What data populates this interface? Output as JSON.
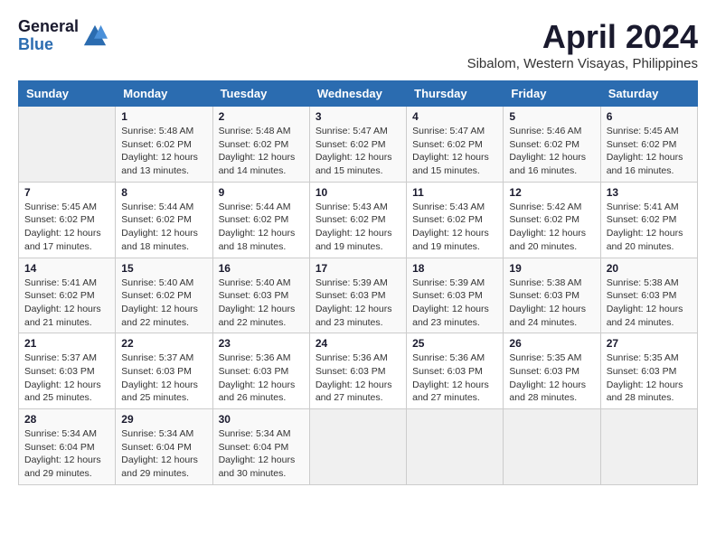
{
  "header": {
    "logo_line1": "General",
    "logo_line2": "Blue",
    "month_title": "April 2024",
    "subtitle": "Sibalom, Western Visayas, Philippines"
  },
  "calendar": {
    "days_of_week": [
      "Sunday",
      "Monday",
      "Tuesday",
      "Wednesday",
      "Thursday",
      "Friday",
      "Saturday"
    ],
    "weeks": [
      [
        {
          "day": "",
          "info": ""
        },
        {
          "day": "1",
          "info": "Sunrise: 5:48 AM\nSunset: 6:02 PM\nDaylight: 12 hours\nand 13 minutes."
        },
        {
          "day": "2",
          "info": "Sunrise: 5:48 AM\nSunset: 6:02 PM\nDaylight: 12 hours\nand 14 minutes."
        },
        {
          "day": "3",
          "info": "Sunrise: 5:47 AM\nSunset: 6:02 PM\nDaylight: 12 hours\nand 15 minutes."
        },
        {
          "day": "4",
          "info": "Sunrise: 5:47 AM\nSunset: 6:02 PM\nDaylight: 12 hours\nand 15 minutes."
        },
        {
          "day": "5",
          "info": "Sunrise: 5:46 AM\nSunset: 6:02 PM\nDaylight: 12 hours\nand 16 minutes."
        },
        {
          "day": "6",
          "info": "Sunrise: 5:45 AM\nSunset: 6:02 PM\nDaylight: 12 hours\nand 16 minutes."
        }
      ],
      [
        {
          "day": "7",
          "info": "Sunrise: 5:45 AM\nSunset: 6:02 PM\nDaylight: 12 hours\nand 17 minutes."
        },
        {
          "day": "8",
          "info": "Sunrise: 5:44 AM\nSunset: 6:02 PM\nDaylight: 12 hours\nand 18 minutes."
        },
        {
          "day": "9",
          "info": "Sunrise: 5:44 AM\nSunset: 6:02 PM\nDaylight: 12 hours\nand 18 minutes."
        },
        {
          "day": "10",
          "info": "Sunrise: 5:43 AM\nSunset: 6:02 PM\nDaylight: 12 hours\nand 19 minutes."
        },
        {
          "day": "11",
          "info": "Sunrise: 5:43 AM\nSunset: 6:02 PM\nDaylight: 12 hours\nand 19 minutes."
        },
        {
          "day": "12",
          "info": "Sunrise: 5:42 AM\nSunset: 6:02 PM\nDaylight: 12 hours\nand 20 minutes."
        },
        {
          "day": "13",
          "info": "Sunrise: 5:41 AM\nSunset: 6:02 PM\nDaylight: 12 hours\nand 20 minutes."
        }
      ],
      [
        {
          "day": "14",
          "info": "Sunrise: 5:41 AM\nSunset: 6:02 PM\nDaylight: 12 hours\nand 21 minutes."
        },
        {
          "day": "15",
          "info": "Sunrise: 5:40 AM\nSunset: 6:02 PM\nDaylight: 12 hours\nand 22 minutes."
        },
        {
          "day": "16",
          "info": "Sunrise: 5:40 AM\nSunset: 6:03 PM\nDaylight: 12 hours\nand 22 minutes."
        },
        {
          "day": "17",
          "info": "Sunrise: 5:39 AM\nSunset: 6:03 PM\nDaylight: 12 hours\nand 23 minutes."
        },
        {
          "day": "18",
          "info": "Sunrise: 5:39 AM\nSunset: 6:03 PM\nDaylight: 12 hours\nand 23 minutes."
        },
        {
          "day": "19",
          "info": "Sunrise: 5:38 AM\nSunset: 6:03 PM\nDaylight: 12 hours\nand 24 minutes."
        },
        {
          "day": "20",
          "info": "Sunrise: 5:38 AM\nSunset: 6:03 PM\nDaylight: 12 hours\nand 24 minutes."
        }
      ],
      [
        {
          "day": "21",
          "info": "Sunrise: 5:37 AM\nSunset: 6:03 PM\nDaylight: 12 hours\nand 25 minutes."
        },
        {
          "day": "22",
          "info": "Sunrise: 5:37 AM\nSunset: 6:03 PM\nDaylight: 12 hours\nand 25 minutes."
        },
        {
          "day": "23",
          "info": "Sunrise: 5:36 AM\nSunset: 6:03 PM\nDaylight: 12 hours\nand 26 minutes."
        },
        {
          "day": "24",
          "info": "Sunrise: 5:36 AM\nSunset: 6:03 PM\nDaylight: 12 hours\nand 27 minutes."
        },
        {
          "day": "25",
          "info": "Sunrise: 5:36 AM\nSunset: 6:03 PM\nDaylight: 12 hours\nand 27 minutes."
        },
        {
          "day": "26",
          "info": "Sunrise: 5:35 AM\nSunset: 6:03 PM\nDaylight: 12 hours\nand 28 minutes."
        },
        {
          "day": "27",
          "info": "Sunrise: 5:35 AM\nSunset: 6:03 PM\nDaylight: 12 hours\nand 28 minutes."
        }
      ],
      [
        {
          "day": "28",
          "info": "Sunrise: 5:34 AM\nSunset: 6:04 PM\nDaylight: 12 hours\nand 29 minutes."
        },
        {
          "day": "29",
          "info": "Sunrise: 5:34 AM\nSunset: 6:04 PM\nDaylight: 12 hours\nand 29 minutes."
        },
        {
          "day": "30",
          "info": "Sunrise: 5:34 AM\nSunset: 6:04 PM\nDaylight: 12 hours\nand 30 minutes."
        },
        {
          "day": "",
          "info": ""
        },
        {
          "day": "",
          "info": ""
        },
        {
          "day": "",
          "info": ""
        },
        {
          "day": "",
          "info": ""
        }
      ]
    ]
  }
}
